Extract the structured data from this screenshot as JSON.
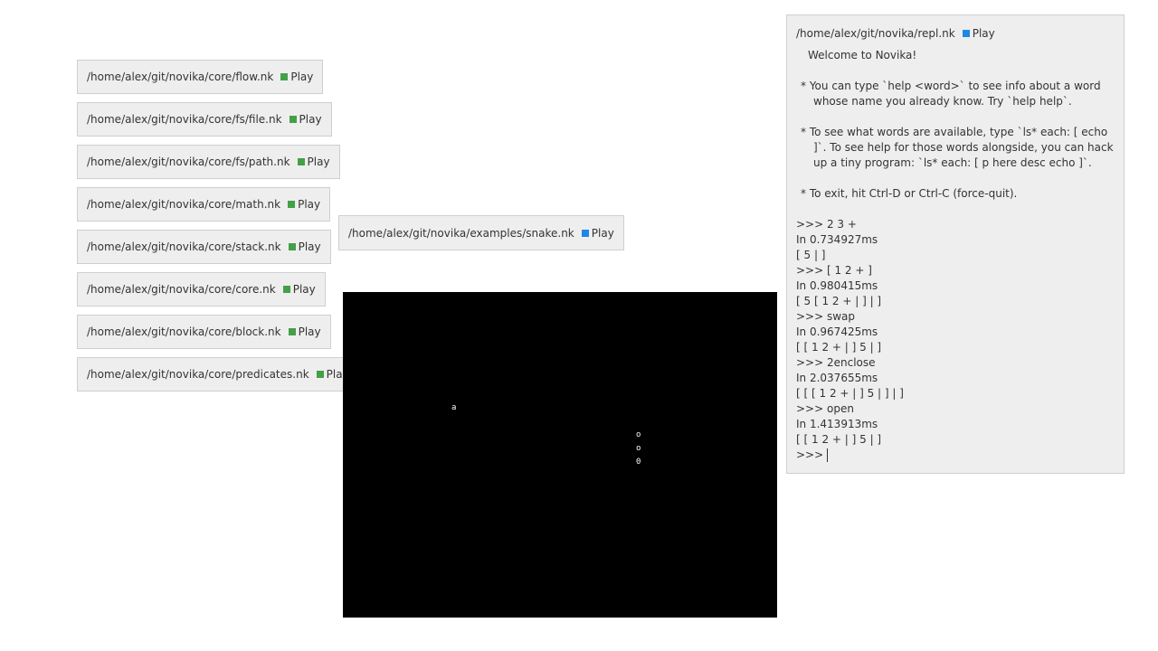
{
  "files": [
    {
      "path": "/home/alex/git/novika/core/flow.nk",
      "play_label": "Play"
    },
    {
      "path": "/home/alex/git/novika/core/fs/file.nk",
      "play_label": "Play"
    },
    {
      "path": "/home/alex/git/novika/core/fs/path.nk",
      "play_label": "Play"
    },
    {
      "path": "/home/alex/git/novika/core/math.nk",
      "play_label": "Play"
    },
    {
      "path": "/home/alex/git/novika/core/stack.nk",
      "play_label": "Play"
    },
    {
      "path": "/home/alex/git/novika/core/core.nk",
      "play_label": "Play"
    },
    {
      "path": "/home/alex/git/novika/core/block.nk",
      "play_label": "Play"
    },
    {
      "path": "/home/alex/git/novika/core/predicates.nk",
      "play_label": "Play"
    }
  ],
  "snake": {
    "path": "/home/alex/git/novika/examples/snake.nk",
    "play_label": "Play",
    "glyphs": {
      "apple": "a",
      "body1": "o",
      "body2": "o",
      "head": "0"
    }
  },
  "repl": {
    "path": "/home/alex/git/novika/repl.nk",
    "play_label": "Play",
    "welcome": "Welcome to Novika!",
    "tips": [
      "* You can type `help <word>` to see info about a word whose name you already know. Try `help help`.",
      "* To see what words are available, type `ls* each: [ echo ]`. To see help for those words alongside, you can hack up a tiny program: `ls* each: [ p here desc echo ]`.",
      "* To exit, hit Ctrl-D or Ctrl-C (force-quit)."
    ],
    "history": [
      ">>> 2 3 +",
      "In 0.734927ms",
      "[ 5 | ]",
      ">>> [ 1 2 + ]",
      "In 0.980415ms",
      "[ 5 [ 1 2 + | ] | ]",
      ">>> swap",
      "In 0.967425ms",
      "[ [ 1 2 + | ] 5 | ]",
      ">>> 2enclose",
      "In 2.037655ms",
      "[ [ [ 1 2 + | ] 5 | ] | ]",
      ">>> open",
      "In 1.413913ms",
      "[ [ 1 2 + | ] 5 | ]"
    ],
    "prompt": ">>>",
    "input_value": ""
  },
  "colors": {
    "play_green": "#43a047",
    "play_blue": "#1e88e5",
    "canvas_bg": "#000000",
    "panel_bg": "#eeeeee"
  }
}
